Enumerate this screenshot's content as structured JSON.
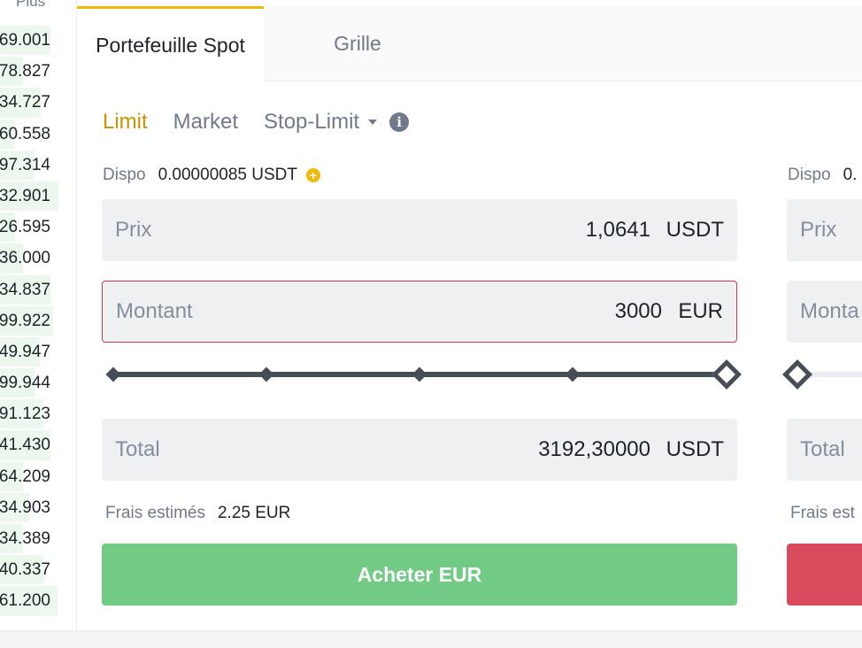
{
  "order_book": {
    "header": "Plus",
    "rows": [
      {
        "value": "69.001",
        "depth": 0.66
      },
      {
        "value": "78.827",
        "depth": 0.3
      },
      {
        "value": "34.727",
        "depth": 0.54
      },
      {
        "value": "60.558",
        "depth": 0.2
      },
      {
        "value": "97.314",
        "depth": 0.44
      },
      {
        "value": "32.901",
        "depth": 0.77
      },
      {
        "value": "26.595",
        "depth": 0.2
      },
      {
        "value": "36.000",
        "depth": 0.3
      },
      {
        "value": "34.837",
        "depth": 0.66
      },
      {
        "value": "99.922",
        "depth": 0.7
      },
      {
        "value": "49.947",
        "depth": 0.52
      },
      {
        "value": "99.944",
        "depth": 0.45
      },
      {
        "value": "91.123",
        "depth": 0.57
      },
      {
        "value": "41.430",
        "depth": 0.66
      },
      {
        "value": "64.209",
        "depth": 0.3
      },
      {
        "value": "34.903",
        "depth": 0.38
      },
      {
        "value": "34.389",
        "depth": 0.3
      },
      {
        "value": "40.337",
        "depth": 0.57
      },
      {
        "value": "61.200",
        "depth": 0.75
      }
    ]
  },
  "tabs": {
    "spot": "Portefeuille Spot",
    "grid": "Grille"
  },
  "order_types": {
    "limit": "Limit",
    "market": "Market",
    "stop_limit": "Stop-Limit",
    "info_icon": "i"
  },
  "buy_form": {
    "dispo_label": "Dispo",
    "dispo_value": "0.00000085 USDT",
    "plus_icon": "+",
    "price_label": "Prix",
    "price_value": "1,0641",
    "price_unit": "USDT",
    "amount_label": "Montant",
    "amount_value": "3000",
    "amount_unit": "EUR",
    "slider_percent": 100,
    "total_label": "Total",
    "total_value": "3192,30000",
    "total_unit": "USDT",
    "fees_label": "Frais estimés",
    "fees_value": "2.25 EUR",
    "button_label": "Acheter EUR"
  },
  "sell_form": {
    "dispo_label": "Dispo",
    "dispo_value": "0.",
    "price_label": "Prix",
    "amount_label": "Monta",
    "slider_percent": 0,
    "total_label": "Total",
    "fees_label": "Frais est"
  },
  "colors": {
    "accent": "#f0b90b",
    "active_order_type": "#c99400",
    "buy_button": "#72cb85",
    "sell_button": "#d94a5c",
    "error_border": "#d9304e"
  }
}
